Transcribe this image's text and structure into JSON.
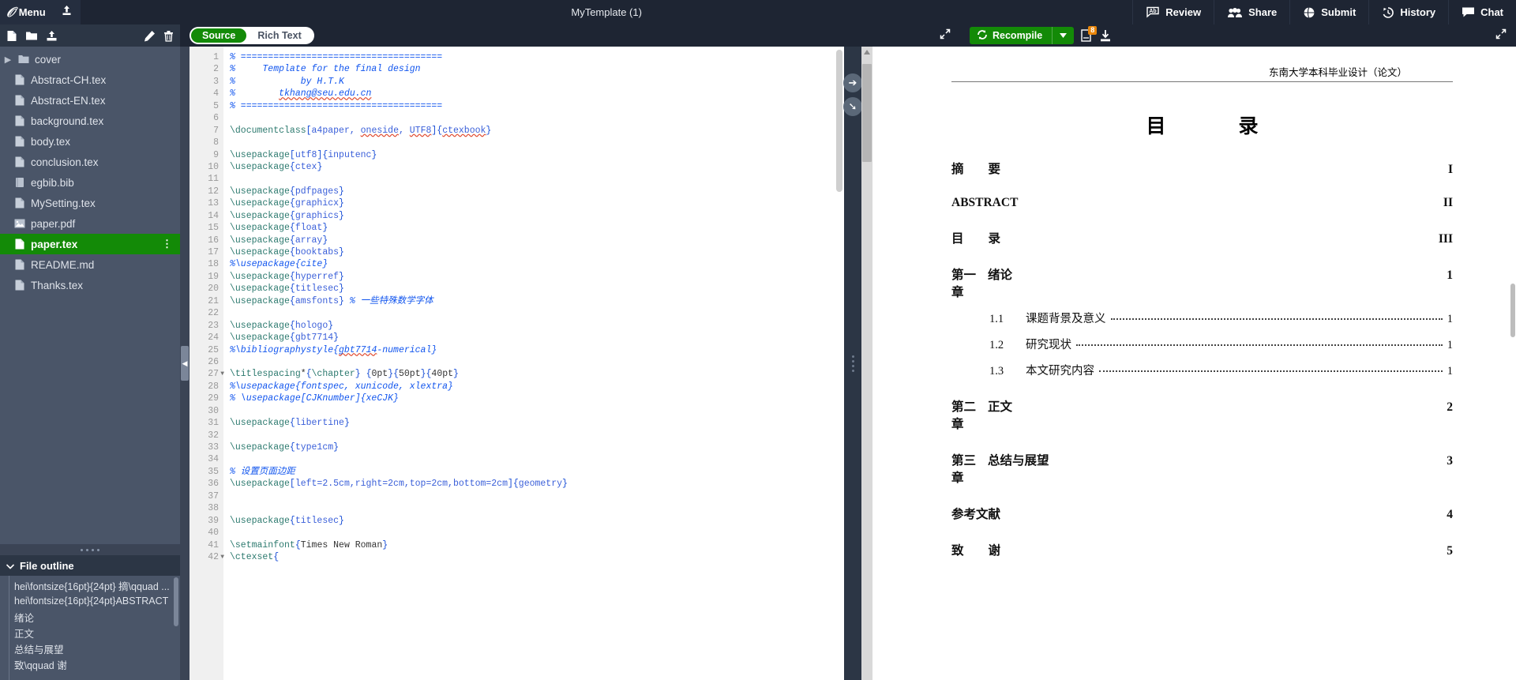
{
  "topbar": {
    "menu_label": "Menu",
    "logo_glyph": "ℳ",
    "upload_icon": "upload-icon",
    "project_title": "MyTemplate (1)",
    "actions": [
      {
        "label": "Review",
        "icon": "review-icon"
      },
      {
        "label": "Share",
        "icon": "share-people-icon"
      },
      {
        "label": "Submit",
        "icon": "submit-globe-icon"
      },
      {
        "label": "History",
        "icon": "history-clock-icon"
      },
      {
        "label": "Chat",
        "icon": "chat-bubble-icon"
      }
    ]
  },
  "file_toolbar": {
    "new_file": "new-file-icon",
    "new_folder": "new-folder-icon",
    "upload": "upload-icon",
    "rename": "pencil-icon",
    "delete": "trash-icon"
  },
  "editor_toolbar": {
    "source_label": "Source",
    "rich_text_label": "Rich Text",
    "active_mode": "Source",
    "expand_icon": "expand-arrows-icon"
  },
  "compile_toolbar": {
    "recompile_label": "Recompile",
    "recompile_icon": "refresh-icon",
    "dropdown_icon": "caret-down-icon",
    "logs_label": "logs-icon",
    "logs_badge": "8",
    "download_label": "download-pdf-icon",
    "expand_icon": "expand-arrows-icon"
  },
  "sidebar": {
    "files": [
      {
        "name": "cover",
        "type": "folder",
        "selected": false
      },
      {
        "name": "Abstract-CH.tex",
        "type": "tex",
        "selected": false
      },
      {
        "name": "Abstract-EN.tex",
        "type": "tex",
        "selected": false
      },
      {
        "name": "background.tex",
        "type": "tex",
        "selected": false
      },
      {
        "name": "body.tex",
        "type": "tex",
        "selected": false
      },
      {
        "name": "conclusion.tex",
        "type": "tex",
        "selected": false
      },
      {
        "name": "egbib.bib",
        "type": "bib",
        "selected": false
      },
      {
        "name": "MySetting.tex",
        "type": "tex",
        "selected": false
      },
      {
        "name": "paper.pdf",
        "type": "pdf",
        "selected": false
      },
      {
        "name": "paper.tex",
        "type": "tex",
        "selected": true
      },
      {
        "name": "README.md",
        "type": "tex",
        "selected": false
      },
      {
        "name": "Thanks.tex",
        "type": "tex",
        "selected": false
      }
    ],
    "outline_title": "File outline",
    "outline_items": [
      "hei\\fontsize{16pt}{24pt} 摘\\qquad ...",
      "hei\\fontsize{16pt}{24pt}ABSTRACT",
      "绪论",
      "正文",
      "总结与展望",
      "致\\qquad 谢"
    ]
  },
  "code": {
    "first_line": 1,
    "lines": [
      {
        "n": 1,
        "fold": false,
        "tokens": [
          {
            "t": "c",
            "s": "% ====================================="
          }
        ]
      },
      {
        "n": 2,
        "fold": false,
        "tokens": [
          {
            "t": "c",
            "s": "%     Template for the final design"
          }
        ]
      },
      {
        "n": 3,
        "fold": false,
        "tokens": [
          {
            "t": "c",
            "s": "%            by H.T.K"
          }
        ]
      },
      {
        "n": 4,
        "fold": false,
        "tokens": [
          {
            "t": "c",
            "s": "%        "
          },
          {
            "t": "cs",
            "s": "tkhang@seu.edu.cn"
          }
        ]
      },
      {
        "n": 5,
        "fold": false,
        "tokens": [
          {
            "t": "c",
            "s": "% ====================================="
          }
        ]
      },
      {
        "n": 6,
        "fold": false,
        "tokens": []
      },
      {
        "n": 7,
        "fold": false,
        "tokens": [
          {
            "t": "k",
            "s": "\\documentclass"
          },
          {
            "t": "b",
            "s": "["
          },
          {
            "t": "o",
            "s": "a4paper, "
          },
          {
            "t": "os",
            "s": "oneside"
          },
          {
            "t": "o",
            "s": ", "
          },
          {
            "t": "os",
            "s": "UTF8"
          },
          {
            "t": "b",
            "s": "]{"
          },
          {
            "t": "os2",
            "s": "ctexbook"
          },
          {
            "t": "b",
            "s": "}"
          }
        ]
      },
      {
        "n": 8,
        "fold": false,
        "tokens": []
      },
      {
        "n": 9,
        "fold": false,
        "tokens": [
          {
            "t": "k",
            "s": "\\usepackage"
          },
          {
            "t": "b",
            "s": "["
          },
          {
            "t": "o",
            "s": "utf8"
          },
          {
            "t": "b",
            "s": "]{"
          },
          {
            "t": "o",
            "s": "inputenc"
          },
          {
            "t": "b",
            "s": "}"
          }
        ]
      },
      {
        "n": 10,
        "fold": false,
        "tokens": [
          {
            "t": "k",
            "s": "\\usepackage"
          },
          {
            "t": "b",
            "s": "{"
          },
          {
            "t": "o",
            "s": "ctex"
          },
          {
            "t": "b",
            "s": "}"
          }
        ]
      },
      {
        "n": 11,
        "fold": false,
        "tokens": []
      },
      {
        "n": 12,
        "fold": false,
        "tokens": [
          {
            "t": "k",
            "s": "\\usepackage"
          },
          {
            "t": "b",
            "s": "{"
          },
          {
            "t": "o",
            "s": "pdfpages"
          },
          {
            "t": "b",
            "s": "}"
          }
        ]
      },
      {
        "n": 13,
        "fold": false,
        "tokens": [
          {
            "t": "k",
            "s": "\\usepackage"
          },
          {
            "t": "b",
            "s": "{"
          },
          {
            "t": "o",
            "s": "graphicx"
          },
          {
            "t": "b",
            "s": "}"
          }
        ]
      },
      {
        "n": 14,
        "fold": false,
        "tokens": [
          {
            "t": "k",
            "s": "\\usepackage"
          },
          {
            "t": "b",
            "s": "{"
          },
          {
            "t": "o",
            "s": "graphics"
          },
          {
            "t": "b",
            "s": "}"
          }
        ]
      },
      {
        "n": 15,
        "fold": false,
        "tokens": [
          {
            "t": "k",
            "s": "\\usepackage"
          },
          {
            "t": "b",
            "s": "{"
          },
          {
            "t": "o",
            "s": "float"
          },
          {
            "t": "b",
            "s": "}"
          }
        ]
      },
      {
        "n": 16,
        "fold": false,
        "tokens": [
          {
            "t": "k",
            "s": "\\usepackage"
          },
          {
            "t": "b",
            "s": "{"
          },
          {
            "t": "o",
            "s": "array"
          },
          {
            "t": "b",
            "s": "}"
          }
        ]
      },
      {
        "n": 17,
        "fold": false,
        "tokens": [
          {
            "t": "k",
            "s": "\\usepackage"
          },
          {
            "t": "b",
            "s": "{"
          },
          {
            "t": "o",
            "s": "booktabs"
          },
          {
            "t": "b",
            "s": "}"
          }
        ]
      },
      {
        "n": 18,
        "fold": false,
        "tokens": [
          {
            "t": "c",
            "s": "%\\usepackage{cite}"
          }
        ]
      },
      {
        "n": 19,
        "fold": false,
        "tokens": [
          {
            "t": "k",
            "s": "\\usepackage"
          },
          {
            "t": "b",
            "s": "{"
          },
          {
            "t": "o",
            "s": "hyperref"
          },
          {
            "t": "b",
            "s": "}"
          }
        ]
      },
      {
        "n": 20,
        "fold": false,
        "tokens": [
          {
            "t": "k",
            "s": "\\usepackage"
          },
          {
            "t": "b",
            "s": "{"
          },
          {
            "t": "o",
            "s": "titlesec"
          },
          {
            "t": "b",
            "s": "}"
          }
        ]
      },
      {
        "n": 21,
        "fold": false,
        "tokens": [
          {
            "t": "k",
            "s": "\\usepackage"
          },
          {
            "t": "b",
            "s": "{"
          },
          {
            "t": "o",
            "s": "amsfonts"
          },
          {
            "t": "b",
            "s": "} "
          },
          {
            "t": "c",
            "s": "% 一些特殊数学字体"
          }
        ]
      },
      {
        "n": 22,
        "fold": false,
        "tokens": []
      },
      {
        "n": 23,
        "fold": false,
        "tokens": [
          {
            "t": "k",
            "s": "\\usepackage"
          },
          {
            "t": "b",
            "s": "{"
          },
          {
            "t": "o",
            "s": "hologo"
          },
          {
            "t": "b",
            "s": "}"
          }
        ]
      },
      {
        "n": 24,
        "fold": false,
        "tokens": [
          {
            "t": "k",
            "s": "\\usepackage"
          },
          {
            "t": "b",
            "s": "{"
          },
          {
            "t": "o",
            "s": "gbt7714"
          },
          {
            "t": "b",
            "s": "}"
          }
        ]
      },
      {
        "n": 25,
        "fold": false,
        "tokens": [
          {
            "t": "c",
            "s": "%\\bibliographystyle{"
          },
          {
            "t": "cs",
            "s": "gbt7714"
          },
          {
            "t": "c",
            "s": "-numerical}"
          }
        ]
      },
      {
        "n": 26,
        "fold": false,
        "tokens": []
      },
      {
        "n": 27,
        "fold": true,
        "tokens": [
          {
            "t": "k",
            "s": "\\titlespacing"
          },
          {
            "t": "x",
            "s": "*"
          },
          {
            "t": "b",
            "s": "{"
          },
          {
            "t": "k",
            "s": "\\chapter"
          },
          {
            "t": "b",
            "s": "}"
          },
          {
            "t": "x",
            "s": " "
          },
          {
            "t": "b",
            "s": "{"
          },
          {
            "t": "x",
            "s": "0pt"
          },
          {
            "t": "b",
            "s": "}{"
          },
          {
            "t": "x",
            "s": "50pt"
          },
          {
            "t": "b",
            "s": "}{"
          },
          {
            "t": "x",
            "s": "40pt"
          },
          {
            "t": "b",
            "s": "}"
          }
        ]
      },
      {
        "n": 28,
        "fold": false,
        "tokens": [
          {
            "t": "c",
            "s": "%\\usepackage{fontspec, xunicode, xlextra}"
          }
        ]
      },
      {
        "n": 29,
        "fold": false,
        "tokens": [
          {
            "t": "c",
            "s": "% \\usepackage[CJKnumber]{xeCJK}"
          }
        ]
      },
      {
        "n": 30,
        "fold": false,
        "tokens": []
      },
      {
        "n": 31,
        "fold": false,
        "tokens": [
          {
            "t": "k",
            "s": "\\usepackage"
          },
          {
            "t": "b",
            "s": "{"
          },
          {
            "t": "o",
            "s": "libertine"
          },
          {
            "t": "b",
            "s": "}"
          }
        ]
      },
      {
        "n": 32,
        "fold": false,
        "tokens": []
      },
      {
        "n": 33,
        "fold": false,
        "tokens": [
          {
            "t": "k",
            "s": "\\usepackage"
          },
          {
            "t": "b",
            "s": "{"
          },
          {
            "t": "o",
            "s": "type1cm"
          },
          {
            "t": "b",
            "s": "}"
          }
        ]
      },
      {
        "n": 34,
        "fold": false,
        "tokens": []
      },
      {
        "n": 35,
        "fold": false,
        "tokens": [
          {
            "t": "c",
            "s": "% 设置页面边距"
          }
        ]
      },
      {
        "n": 36,
        "fold": false,
        "tokens": [
          {
            "t": "k",
            "s": "\\usepackage"
          },
          {
            "t": "b",
            "s": "["
          },
          {
            "t": "o",
            "s": "left=2.5cm,right=2cm,top=2cm,bottom=2cm"
          },
          {
            "t": "b",
            "s": "]{"
          },
          {
            "t": "o",
            "s": "geometry"
          },
          {
            "t": "b",
            "s": "}"
          }
        ]
      },
      {
        "n": 37,
        "fold": false,
        "tokens": []
      },
      {
        "n": 38,
        "fold": false,
        "tokens": []
      },
      {
        "n": 39,
        "fold": false,
        "tokens": [
          {
            "t": "k",
            "s": "\\usepackage"
          },
          {
            "t": "b",
            "s": "{"
          },
          {
            "t": "o",
            "s": "titlesec"
          },
          {
            "t": "b",
            "s": "}"
          }
        ]
      },
      {
        "n": 40,
        "fold": false,
        "tokens": []
      },
      {
        "n": 41,
        "fold": false,
        "tokens": [
          {
            "t": "k",
            "s": "\\setmainfont"
          },
          {
            "t": "b",
            "s": "{"
          },
          {
            "t": "x",
            "s": "Times New Roman"
          },
          {
            "t": "b",
            "s": "}"
          }
        ]
      },
      {
        "n": 42,
        "fold": true,
        "tokens": [
          {
            "t": "k",
            "s": "\\ctexset"
          },
          {
            "t": "b",
            "s": "{"
          }
        ]
      }
    ]
  },
  "pdf": {
    "running_header": "东南大学本科毕业设计（论文）",
    "page_title": "目　　录",
    "toc": [
      {
        "level": 0,
        "num": "",
        "label": "摘　　要",
        "page": "I",
        "dots": false
      },
      {
        "level": 0,
        "num": "",
        "label": "ABSTRACT",
        "page": "II",
        "dots": false
      },
      {
        "level": 0,
        "num": "",
        "label": "目　　录",
        "page": "III",
        "dots": false
      },
      {
        "level": 0,
        "num": "第一章",
        "label": "绪论",
        "page": "1",
        "dots": false
      },
      {
        "level": 1,
        "num": "1.1",
        "label": "课题背景及意义",
        "page": "1",
        "dots": true
      },
      {
        "level": 1,
        "num": "1.2",
        "label": "研究现状",
        "page": "1",
        "dots": true
      },
      {
        "level": 1,
        "num": "1.3",
        "label": "本文研究内容",
        "page": "1",
        "dots": true
      },
      {
        "level": 0,
        "num": "第二章",
        "label": "正文",
        "page": "2",
        "dots": false
      },
      {
        "level": 0,
        "num": "第三章",
        "label": "总结与展望",
        "page": "3",
        "dots": false
      },
      {
        "level": 0,
        "num": "",
        "label": "参考文献",
        "page": "4",
        "dots": false
      },
      {
        "level": 0,
        "num": "",
        "label": "致　　谢",
        "page": "5",
        "dots": false
      }
    ]
  },
  "colors": {
    "accent_green": "#138a07",
    "topbar_bg": "#1e2533",
    "sidebar_bg": "#4a5568",
    "badge_orange": "#e8850a",
    "comment_blue": "#1155ee",
    "command_teal": "#2d7a6f"
  }
}
